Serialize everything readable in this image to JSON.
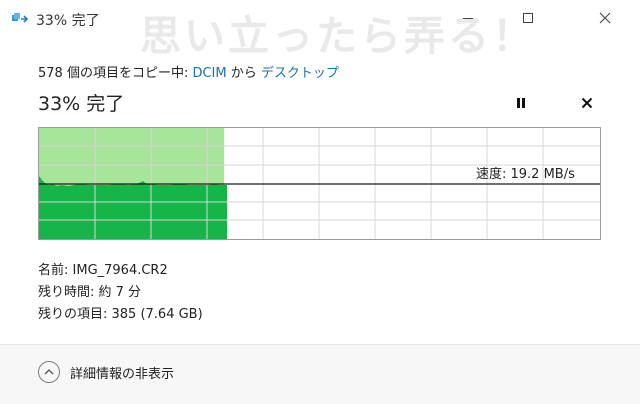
{
  "window": {
    "title": "33% 完了",
    "watermark": "思い立ったら弄る！",
    "icon": "copy-arrow-icon"
  },
  "copy": {
    "prefix": "578 個の項目をコピー中: ",
    "source": "DCIM",
    "connector": " から ",
    "destination": "デスクトップ",
    "percent_title": "33% 完了",
    "progress": 0.33
  },
  "graph": {
    "speed_label": "速度: 19.2 MB/s",
    "fill_color": "#16b54a",
    "progress_color": "#a7e59a"
  },
  "details": {
    "name": "名前:  IMG_7964.CR2",
    "time_left": "残り時間:  約 7 分",
    "items_left": "残りの項目:  385 (7.64 GB)"
  },
  "footer": {
    "toggle_label": "詳細情報の非表示"
  },
  "colors": {
    "link": "#1a6fb5",
    "graph_green": "#16b54a",
    "progress_green": "#a7e59a"
  }
}
